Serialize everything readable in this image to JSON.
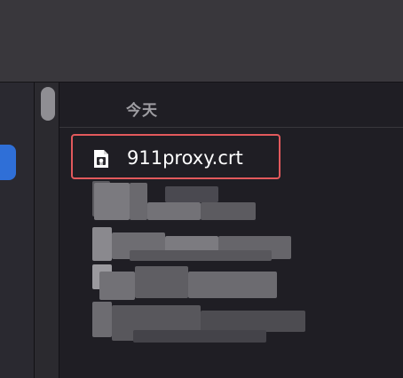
{
  "content": {
    "section_header": "今天",
    "selected_file": {
      "name": "911proxy.crt",
      "icon": "certificate-file-icon"
    },
    "redacted_rows": [
      {
        "icon": "blurred-file-icon"
      },
      {
        "icon": "blurred-file-icon"
      },
      {
        "icon": "blurred-file-icon"
      },
      {
        "icon": "blurred-file-icon"
      }
    ]
  },
  "colors": {
    "highlight_border": "#e2595c",
    "sidebar_selection": "#2f6fd7",
    "background": "#1f1e24",
    "toolbar": "#39373c"
  }
}
